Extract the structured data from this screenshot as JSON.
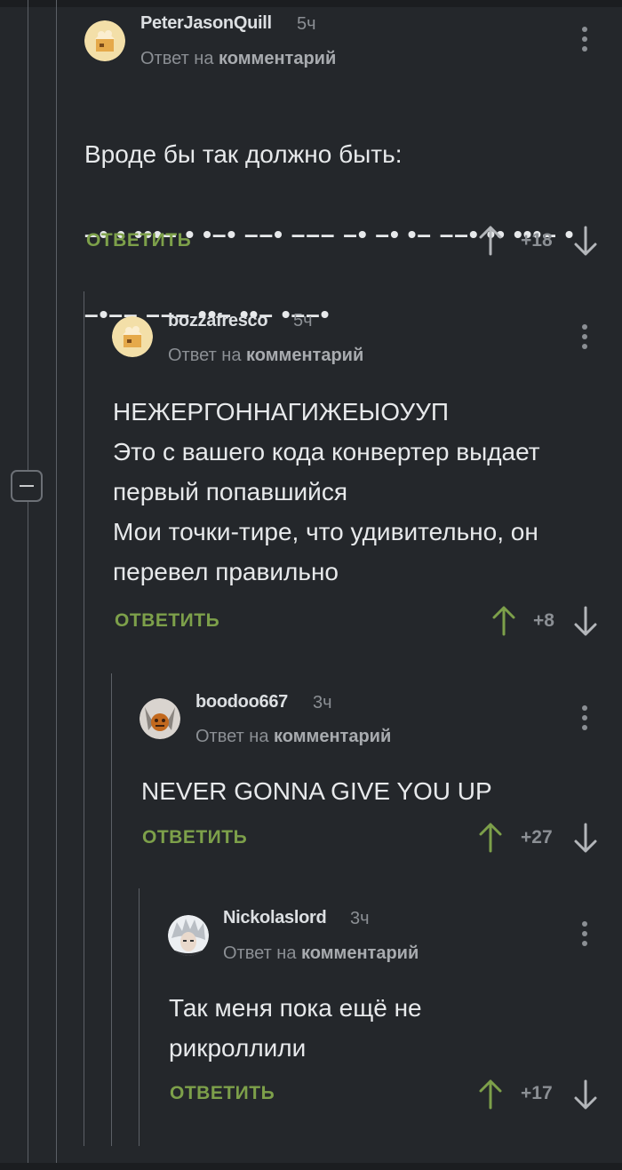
{
  "comments": [
    {
      "username": "PeterJasonQuill",
      "time": "5ч",
      "reply_prefix": "Ответ на",
      "reply_link": "комментарий",
      "text_line1": "Вроде бы так должно быть:",
      "morse_line1": "–• • •••– • •–• ––• ––– –• –• •– ––• •• •••– •",
      "morse_line2": "–•–– ––– ••– ••– •––•",
      "reply_label": "ОТВЕТИТЬ",
      "score": "+18",
      "up_voted": false
    },
    {
      "username": "bozzafresco",
      "time": "5ч",
      "reply_prefix": "Ответ на",
      "reply_link": "комментарий",
      "text": "НЕЖЕРГОННАГИЖЕЫОУУП\nЭто с вашего кода конвертер выдает\nпервый попавшийся\nМои точки-тире, что удивительно, он\nперевел правильно",
      "reply_label": "ОТВЕТИТЬ",
      "score": "+8",
      "up_voted": true
    },
    {
      "username": "boodoo667",
      "time": "3ч",
      "reply_prefix": "Ответ на",
      "reply_link": "комментарий",
      "text": "NEVER GONNA GIVE YOU UP",
      "reply_label": "ОТВЕТИТЬ",
      "score": "+27",
      "up_voted": true
    },
    {
      "username": "Nickolaslord",
      "time": "3ч",
      "reply_prefix": "Ответ на",
      "reply_link": "комментарий",
      "text": "Так меня пока ещё не\nрикроллили",
      "reply_label": "ОТВЕТИТЬ",
      "score": "+17",
      "up_voted": true
    }
  ],
  "colors": {
    "background": "#24272b",
    "accent_green": "#7da04a",
    "muted": "#8b8f94",
    "thread_line": "#5c6066"
  }
}
